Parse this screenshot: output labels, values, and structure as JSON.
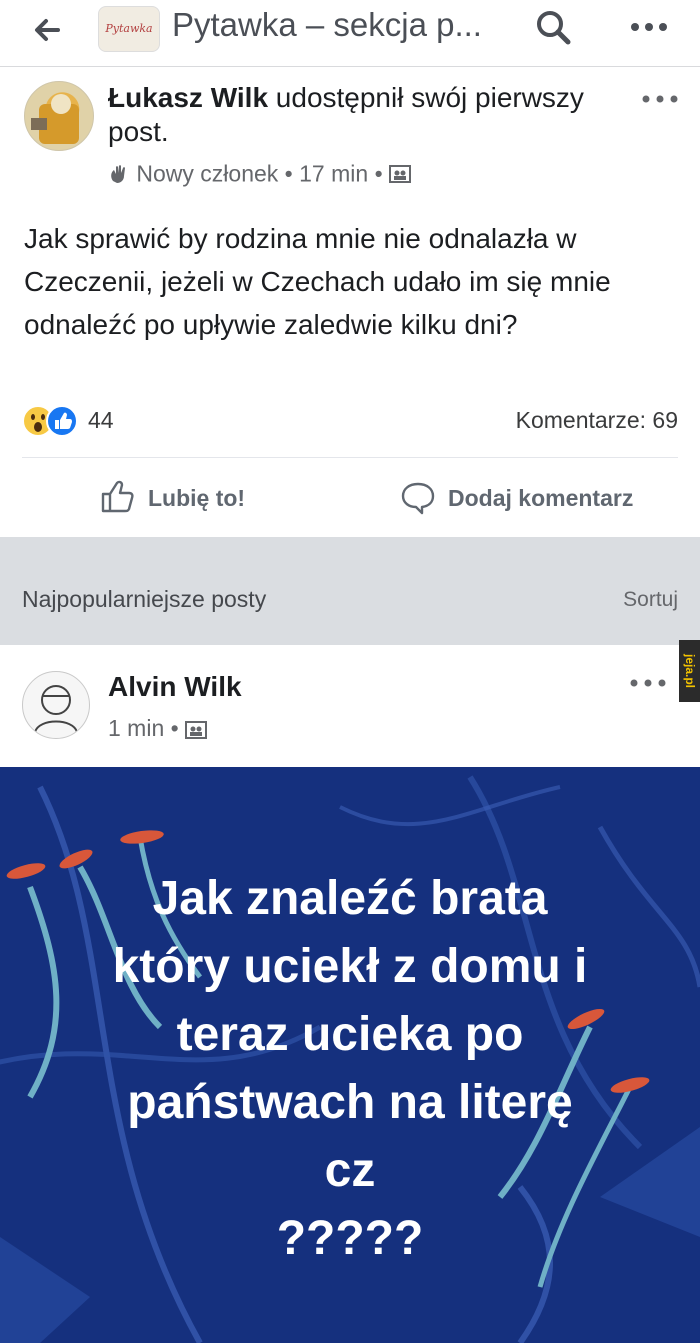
{
  "header": {
    "back_icon": "arrow-left-icon",
    "group_thumb_text": "Pytawka",
    "title": "Pytawka – sekcja p...",
    "search_icon": "search-icon",
    "more_icon": "more-horizontal-icon"
  },
  "post1": {
    "author": "Łukasz Wilk",
    "action": " udostępnił swój pierwszy post.",
    "badge_icon": "wave-hand-icon",
    "badge": "Nowy członek",
    "time": "17 min",
    "privacy_icon": "group-privacy-icon",
    "text": "Jak sprawić by rodzina mnie nie odnalazła w Czeczenii, jeżeli w Czechach udało im się mnie odnaleźć po upływie zaledwie kilku dni?",
    "reactions": [
      "wow-reaction-icon",
      "like-reaction-icon"
    ],
    "reaction_count": "44",
    "comments": "Komentarze: 69",
    "like_label": "Lubię to!",
    "comment_label": "Dodaj komentarz"
  },
  "section": {
    "title": "Najpopularniejsze posty",
    "sort": "Sortuj"
  },
  "post2": {
    "author": "Alvin Wilk",
    "time": "1 min",
    "privacy_icon": "group-privacy-icon",
    "image_lines": [
      "Jak znaleźć brata",
      "który uciekł z domu i",
      "teraz ucieka po",
      "państwach na literę",
      "cz",
      "?????"
    ]
  },
  "watermark": "jeja.pl",
  "colors": {
    "image_bg": "#15307e",
    "gap_bg": "#dadde1",
    "meta_text": "#65676b"
  }
}
